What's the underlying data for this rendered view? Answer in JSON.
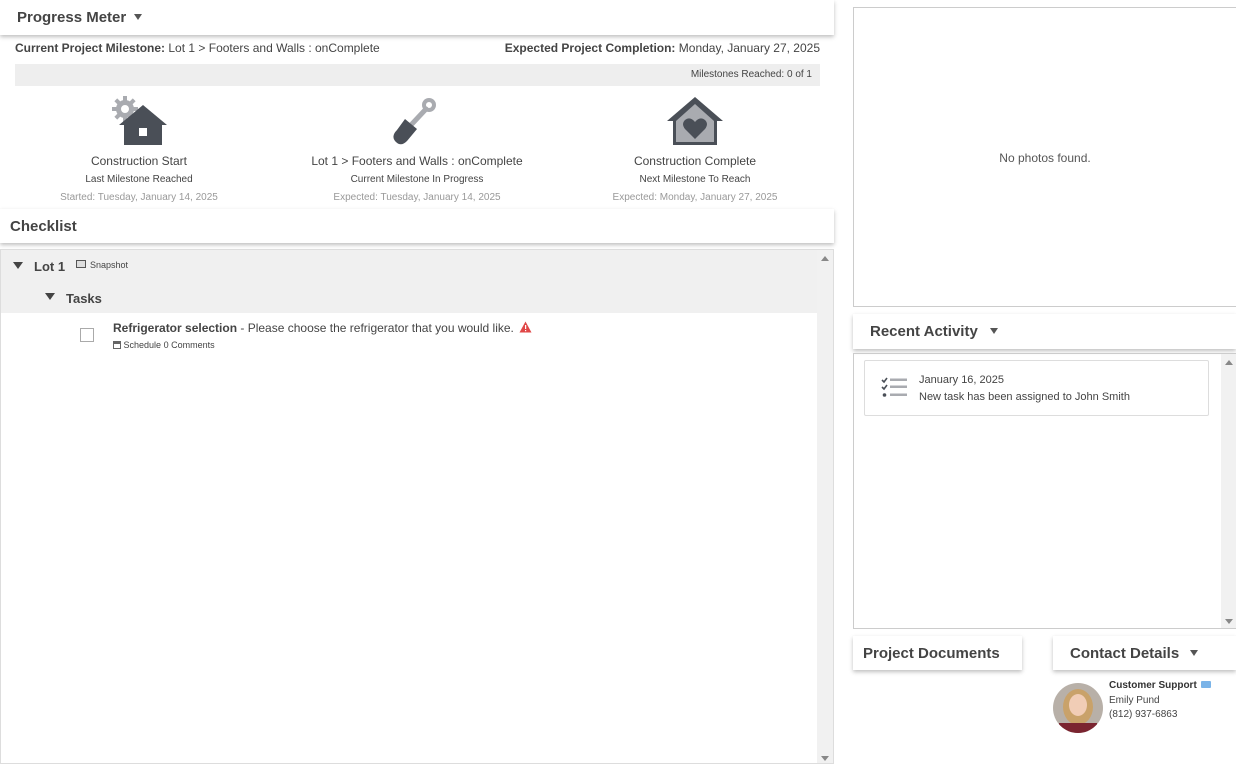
{
  "progress": {
    "title": "Progress Meter",
    "current_label": "Current Project Milestone:",
    "current_value": "Lot 1 > Footers and Walls : onComplete",
    "expected_label": "Expected Project Completion:",
    "expected_value": "Monday, January 27, 2025",
    "milestones_reached": "Milestones Reached: 0 of 1",
    "milestones": [
      {
        "name": "Construction Start",
        "sub": "Last Milestone Reached",
        "date": "Started: Tuesday, January 14, 2025",
        "icon": "house-gear-icon"
      },
      {
        "name": "Lot 1 > Footers and Walls : onComplete",
        "sub": "Current Milestone In Progress",
        "date": "Expected: Tuesday, January 14, 2025",
        "icon": "shovel-icon"
      },
      {
        "name": "Construction Complete",
        "sub": "Next Milestone To Reach",
        "date": "Expected: Monday, January 27, 2025",
        "icon": "house-heart-icon"
      }
    ]
  },
  "checklist": {
    "title": "Checklist",
    "group": "Lot 1",
    "snapshot": "Snapshot",
    "subgroup": "Tasks",
    "task_title": "Refrigerator selection",
    "task_desc": " - Please choose the refrigerator that you would like.",
    "schedule": "Schedule",
    "comments": "0 Comments"
  },
  "photos": {
    "empty": "No photos found."
  },
  "activity": {
    "title": "Recent Activity",
    "items": [
      {
        "date": "January 16, 2025",
        "text": "New task has been assigned to John Smith"
      }
    ]
  },
  "documents": {
    "title": "Project Documents"
  },
  "contact": {
    "title": "Contact Details",
    "role": "Customer Support",
    "name": "Emily Pund",
    "phone": "(812) 937-6863"
  },
  "colors": {
    "icon_dark": "#4a4f57",
    "icon_light": "#a9abb0",
    "warning": "#e04848"
  }
}
